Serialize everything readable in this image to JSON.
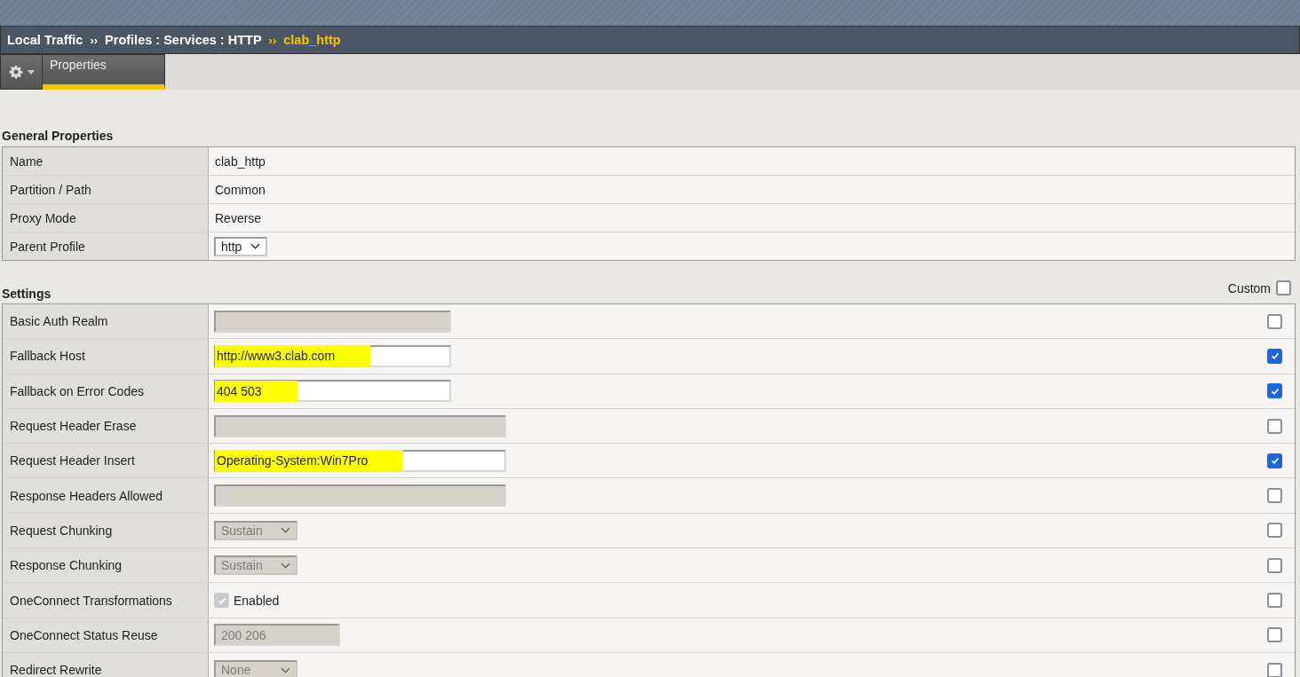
{
  "breadcrumb": {
    "items": [
      "Local Traffic",
      "Profiles : Services : HTTP"
    ],
    "current": "clab_http",
    "separator": "››"
  },
  "tabs": [
    {
      "label": "Properties",
      "selected": true
    }
  ],
  "general": {
    "title": "General Properties",
    "rows": [
      {
        "label": "Name",
        "kind": "text",
        "value": "clab_http"
      },
      {
        "label": "Partition / Path",
        "kind": "text",
        "value": "Common"
      },
      {
        "label": "Proxy Mode",
        "kind": "text",
        "value": "Reverse"
      },
      {
        "label": "Parent Profile",
        "kind": "select",
        "value": "http",
        "disabled": false
      }
    ]
  },
  "settings": {
    "title": "Settings",
    "custom_label": "Custom",
    "custom_checked": false,
    "rows": [
      {
        "label": "Basic Auth Realm",
        "kind": "input",
        "disabled": true,
        "checked": false
      },
      {
        "label": "Fallback Host",
        "kind": "input",
        "value": "http://www3.clab.com",
        "disabled": false,
        "highlighted": true,
        "checked": true
      },
      {
        "label": "Fallback on Error Codes",
        "kind": "input",
        "value": "404 503",
        "disabled": false,
        "highlighted": true,
        "checked": true
      },
      {
        "label": "Request Header Erase",
        "kind": "input",
        "disabled": true,
        "checked": false
      },
      {
        "label": "Request Header Insert",
        "kind": "input",
        "value": "Operating-System:Win7Pro",
        "disabled": false,
        "highlighted": true,
        "checked": true
      },
      {
        "label": "Response Headers Allowed",
        "kind": "input",
        "disabled": true,
        "checked": false
      },
      {
        "label": "Request Chunking",
        "kind": "select",
        "value": "Sustain",
        "disabled": true,
        "checked": false
      },
      {
        "label": "Response Chunking",
        "kind": "select",
        "value": "Sustain",
        "disabled": true,
        "checked": false
      },
      {
        "label": "OneConnect Transformations",
        "kind": "checkbox",
        "value": "Enabled",
        "on": true,
        "disabled": true,
        "checked": false
      },
      {
        "label": "OneConnect Status Reuse",
        "kind": "input",
        "value": "200 206",
        "disabled": true,
        "highlighted": false,
        "checked": false
      },
      {
        "label": "Redirect Rewrite",
        "kind": "select",
        "value": "None",
        "disabled": true,
        "checked": false
      }
    ]
  }
}
